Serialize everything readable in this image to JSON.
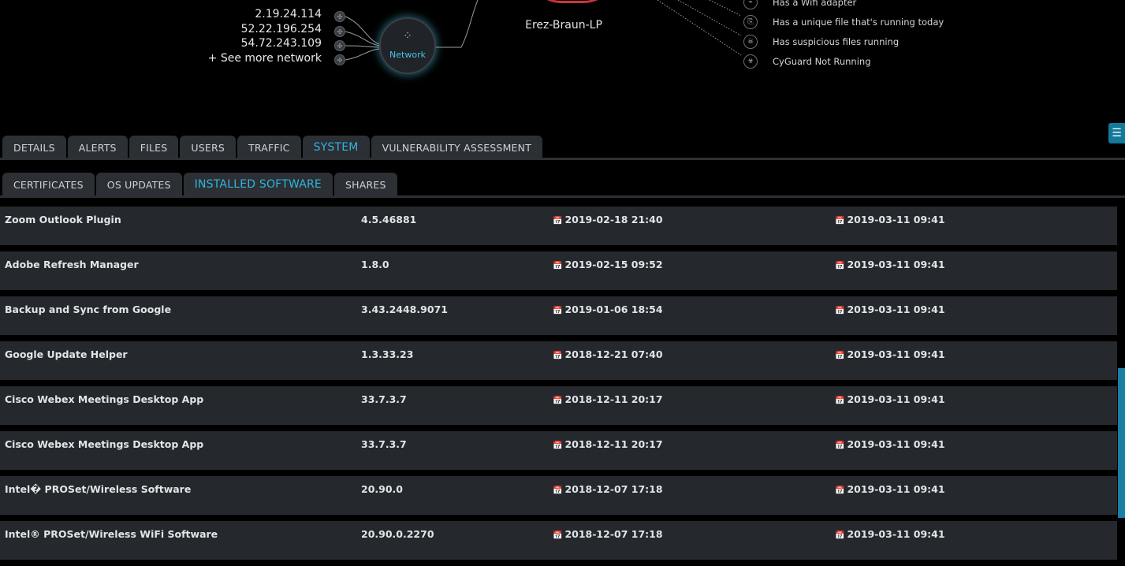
{
  "network": {
    "ips": [
      "2.19.24.114",
      "52.22.196.254",
      "54.72.243.109",
      "+ See more network"
    ],
    "node_label": "Network",
    "node_icon": "network-icon"
  },
  "host": {
    "name": "Erez-Braun-LP",
    "ring_color": "#c93540"
  },
  "alerts": [
    {
      "icon": "adapter-icon",
      "text": "Has a Wifi adapter"
    },
    {
      "icon": "unique-file-icon",
      "text": "Has a unique file that's running today"
    },
    {
      "icon": "suspicious-file-icon",
      "text": "Has suspicious files running"
    },
    {
      "icon": "biohazard-icon",
      "text": "CyGuard Not Running"
    }
  ],
  "tabs": [
    "DETAILS",
    "ALERTS",
    "FILES",
    "USERS",
    "TRAFFIC",
    "SYSTEM",
    "VULNERABILITY ASSESSMENT"
  ],
  "active_tab": "SYSTEM",
  "subtabs": [
    "CERTIFICATES",
    "OS UPDATES",
    "INSTALLED SOFTWARE",
    "SHARES"
  ],
  "active_subtab": "INSTALLED SOFTWARE",
  "accent_color": "#2fb5e0",
  "software": [
    {
      "name": "Zoom Outlook Plugin",
      "version": "4.5.46881",
      "installed": "2019-02-18 21:40",
      "seen": "2019-03-11 09:41"
    },
    {
      "name": "Adobe Refresh Manager",
      "version": "1.8.0",
      "installed": "2019-02-15 09:52",
      "seen": "2019-03-11 09:41"
    },
    {
      "name": "Backup and Sync from Google",
      "version": "3.43.2448.9071",
      "installed": "2019-01-06 18:54",
      "seen": "2019-03-11 09:41"
    },
    {
      "name": "Google Update Helper",
      "version": "1.3.33.23",
      "installed": "2018-12-21 07:40",
      "seen": "2019-03-11 09:41"
    },
    {
      "name": "Cisco Webex Meetings Desktop App",
      "version": "33.7.3.7",
      "installed": "2018-12-11 20:17",
      "seen": "2019-03-11 09:41"
    },
    {
      "name": "Cisco Webex Meetings Desktop App",
      "version": "33.7.3.7",
      "installed": "2018-12-11 20:17",
      "seen": "2019-03-11 09:41"
    },
    {
      "name": "Intel� PROSet/Wireless Software",
      "version": "20.90.0",
      "installed": "2018-12-07 17:18",
      "seen": "2019-03-11 09:41"
    },
    {
      "name": "Intel® PROSet/Wireless WiFi Software",
      "version": "20.90.0.2270",
      "installed": "2018-12-07 17:18",
      "seen": "2019-03-11 09:41"
    }
  ]
}
